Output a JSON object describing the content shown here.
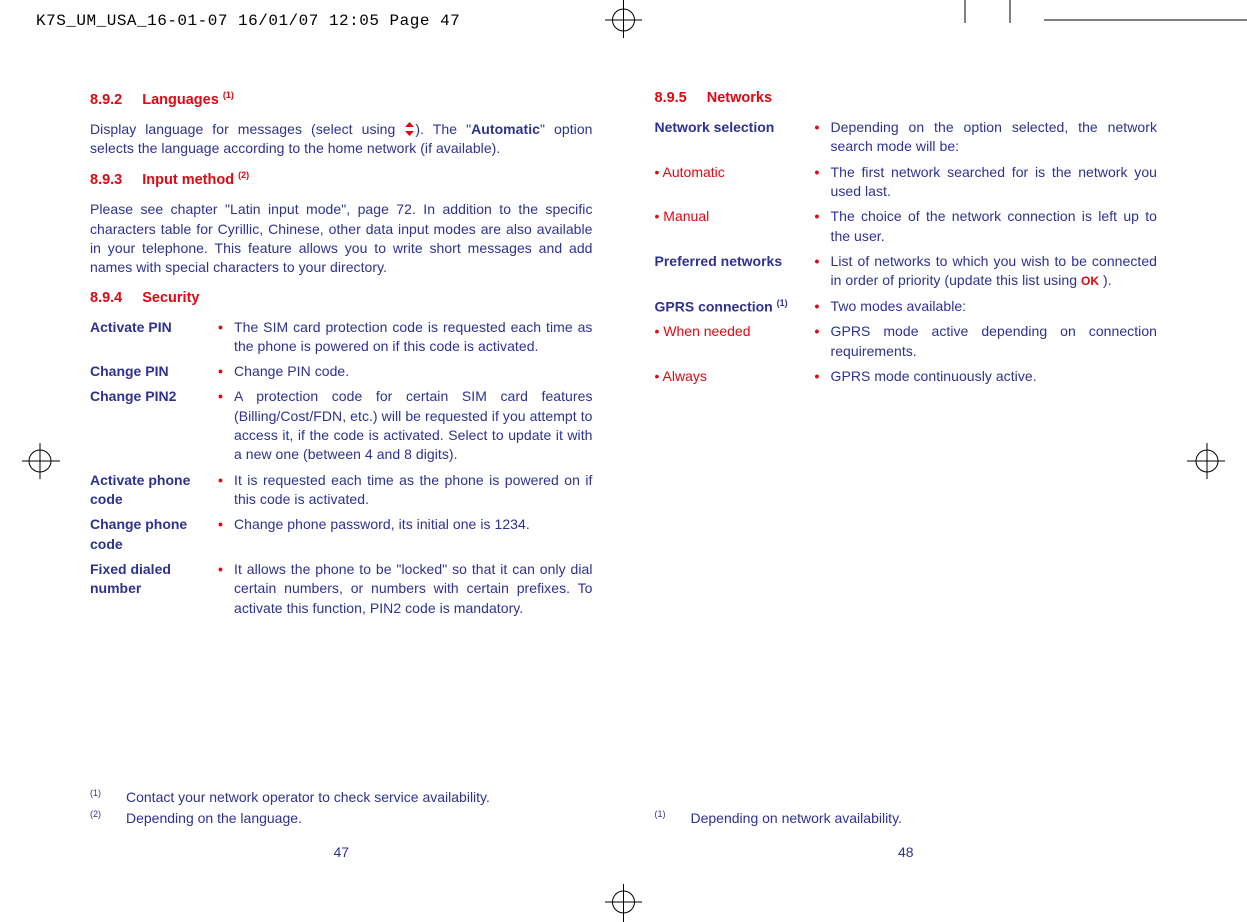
{
  "print_header": "K7S_UM_USA_16-01-07  16/01/07  12:05  Page 47",
  "left": {
    "sec1": {
      "num": "8.9.2",
      "title": "Languages",
      "sup": "(1)"
    },
    "sec1_text_a": "Display language for messages (select using ",
    "sec1_text_b": "). The \"",
    "sec1_text_bold": "Automatic",
    "sec1_text_c": "\" option selects the language according to the home network (if available).",
    "sec2": {
      "num": "8.9.3",
      "title": "Input method",
      "sup": "(2)"
    },
    "sec2_text": "Please see chapter \"Latin input mode\", page 72. In addition to the specific characters table for Cyrillic, Chinese, other data input modes are also available in your telephone. This feature allows you to write short messages and add names with special characters to your directory.",
    "sec3": {
      "num": "8.9.4",
      "title": "Security"
    },
    "items": [
      {
        "term": "Activate PIN",
        "desc": "The SIM card protection code is requested each time as the phone is powered on if this code is activated."
      },
      {
        "term": "Change PIN",
        "desc": "Change PIN code."
      },
      {
        "term": "Change PIN2",
        "desc": "A protection code for certain SIM card features (Billing/Cost/FDN, etc.) will be requested if you attempt to access it, if the code is activated. Select to update it with a new one (between 4 and 8 digits)."
      },
      {
        "term": "Activate phone code",
        "desc": "It is requested each time as the phone is powered on if this code is activated."
      },
      {
        "term": "Change phone code",
        "desc": "Change phone password, its initial one is 1234."
      },
      {
        "term": "Fixed dialed number",
        "desc": "It allows the phone to be \"locked\" so that it can only dial certain numbers, or numbers with certain prefixes. To activate this function, PIN2 code is mandatory."
      }
    ],
    "fn1_mark": "(1)",
    "fn1": "Contact your network operator to check service availability.",
    "fn2_mark": "(2)",
    "fn2": "Depending on the language.",
    "pagenum": "47"
  },
  "right": {
    "sec1": {
      "num": "8.9.5",
      "title": "Networks"
    },
    "items": [
      {
        "term": "Network selection",
        "bold": true,
        "desc": "Depending on the option selected, the network search mode will be:"
      },
      {
        "term": "Automatic",
        "sub": true,
        "desc": "The first network searched for is the network you used last."
      },
      {
        "term": "Manual",
        "sub": true,
        "desc": "The choice of the network connection is left up to the user."
      },
      {
        "term": "Preferred networks",
        "bold": true,
        "desc_a": "List of networks to which you wish to be connected in order of priority (update this list using ",
        "desc_b": " )."
      },
      {
        "term": "GPRS connection",
        "bold": true,
        "sup": "(1)",
        "desc": "Two modes available:"
      },
      {
        "term": "When needed",
        "sub": true,
        "desc": "GPRS mode active depending on connection requirements."
      },
      {
        "term": "Always",
        "sub": true,
        "desc": "GPRS mode continuously active."
      }
    ],
    "fn1_mark": "(1)",
    "fn1": "Depending on network availability.",
    "pagenum": "48"
  }
}
